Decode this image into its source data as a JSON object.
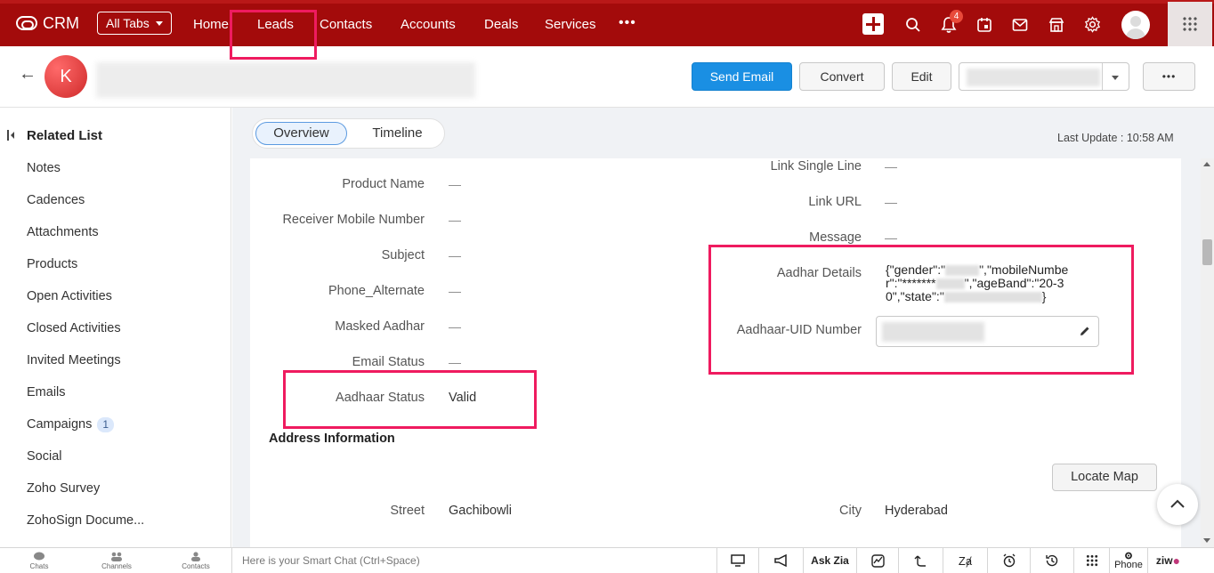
{
  "topbar": {
    "app_name": "CRM",
    "all_tabs_label": "All Tabs",
    "tabs": [
      {
        "label": "Home"
      },
      {
        "label": "Leads"
      },
      {
        "label": "Contacts"
      },
      {
        "label": "Accounts"
      },
      {
        "label": "Deals"
      },
      {
        "label": "Services"
      }
    ],
    "more_label": "•••",
    "notification_count": "4",
    "colors": {
      "brand": "#a30b0b",
      "accent": "#ef1b5f",
      "primary_button": "#1a8fe3"
    }
  },
  "record": {
    "avatar_initial": "K",
    "buttons": {
      "send_email": "Send Email",
      "convert": "Convert",
      "edit": "Edit",
      "more": "•••"
    }
  },
  "sidebar": {
    "title": "Related List",
    "items": [
      {
        "label": "Notes"
      },
      {
        "label": "Cadences"
      },
      {
        "label": "Attachments"
      },
      {
        "label": "Products"
      },
      {
        "label": "Open Activities"
      },
      {
        "label": "Closed Activities"
      },
      {
        "label": "Invited Meetings"
      },
      {
        "label": "Emails"
      },
      {
        "label": "Campaigns",
        "badge": "1"
      },
      {
        "label": "Social"
      },
      {
        "label": "Zoho Survey"
      },
      {
        "label": "ZohoSign Docume..."
      }
    ]
  },
  "main": {
    "tabs": {
      "overview": "Overview",
      "timeline": "Timeline"
    },
    "last_update": "Last Update : 10:58 AM",
    "left_fields": [
      {
        "label": "Product Name",
        "value": "—"
      },
      {
        "label": "Receiver Mobile Number",
        "value": "—"
      },
      {
        "label": "Subject",
        "value": "—"
      },
      {
        "label": "Phone_Alternate",
        "value": "—"
      },
      {
        "label": "Masked Aadhar",
        "value": "—"
      },
      {
        "label": "Email Status",
        "value": "—"
      },
      {
        "label": "Aadhaar Status",
        "value": "Valid"
      }
    ],
    "right_fields": [
      {
        "label": "Link Single Line",
        "value": "—"
      },
      {
        "label": "Link URL",
        "value": "—"
      },
      {
        "label": "Message",
        "value": "—"
      }
    ],
    "aadhar_details": {
      "label": "Aadhar Details",
      "parts": [
        "{\"gender\":\"",
        "\",\"mobileNumber\":\"*******",
        "\",\"ageBand\":\"20-30\",\"state\":\"",
        "}"
      ]
    },
    "aadhaar_uid": {
      "label": "Aadhaar-UID Number"
    },
    "address": {
      "title": "Address Information",
      "locate_map": "Locate Map",
      "street_label": "Street",
      "street_value": "Gachibowli",
      "city_label": "City",
      "city_value": "Hyderabad"
    }
  },
  "bottombar": {
    "chats": "Chats",
    "channels": "Channels",
    "contacts": "Contacts",
    "smart_chat_placeholder": "Here is your Smart Chat (Ctrl+Space)",
    "ask_zia": "Ask Zia",
    "phone": "Phone",
    "brand": "ziw"
  }
}
